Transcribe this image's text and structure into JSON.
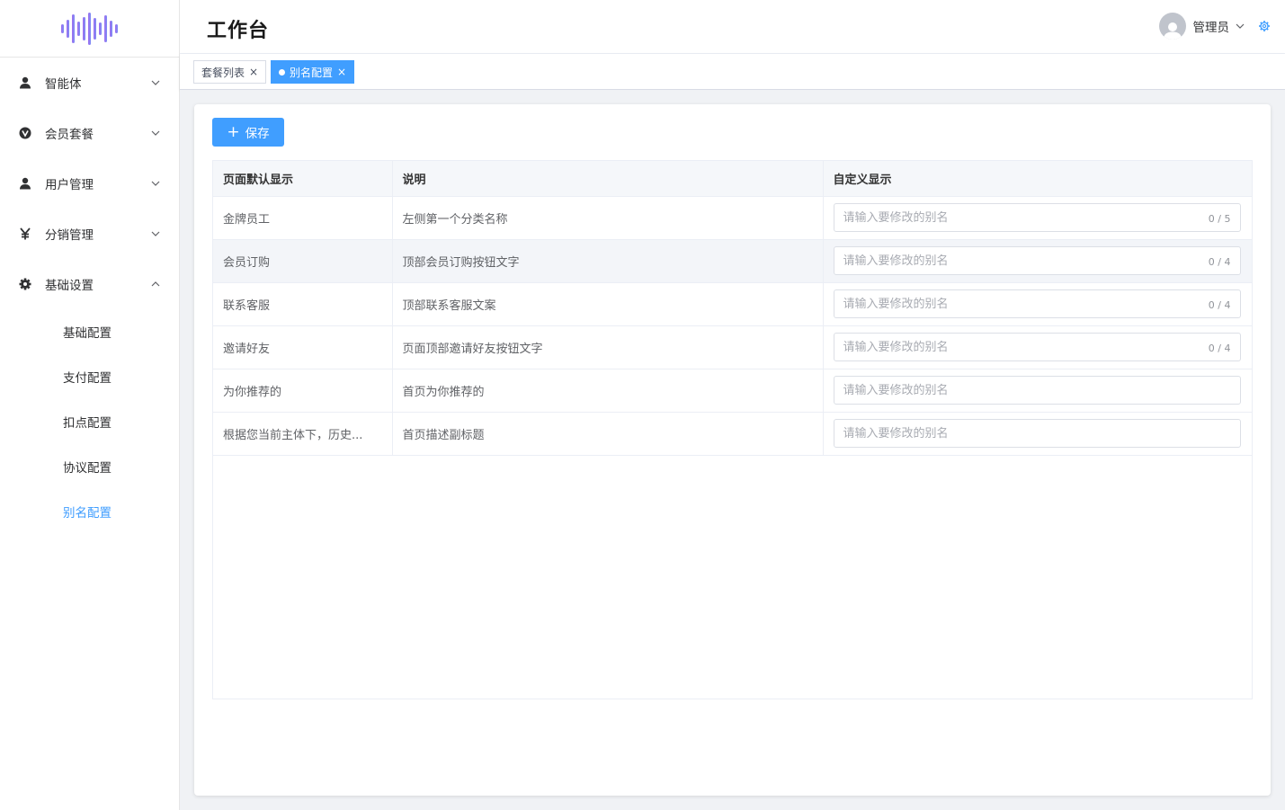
{
  "header": {
    "title": "工作台",
    "user_name": "管理员"
  },
  "sidebar": {
    "items": [
      {
        "label": "智能体",
        "icon": "user-icon",
        "expanded": false
      },
      {
        "label": "会员套餐",
        "icon": "vip-icon",
        "expanded": false
      },
      {
        "label": "用户管理",
        "icon": "user-icon",
        "expanded": false
      },
      {
        "label": "分销管理",
        "icon": "yen-icon",
        "expanded": false
      },
      {
        "label": "基础设置",
        "icon": "gear-icon",
        "expanded": true
      }
    ],
    "submenu": [
      {
        "label": "基础配置",
        "active": false
      },
      {
        "label": "支付配置",
        "active": false
      },
      {
        "label": "扣点配置",
        "active": false
      },
      {
        "label": "协议配置",
        "active": false
      },
      {
        "label": "别名配置",
        "active": true
      }
    ]
  },
  "tabs": [
    {
      "label": "套餐列表",
      "active": false
    },
    {
      "label": "别名配置",
      "active": true
    }
  ],
  "toolbar": {
    "save_label": "保存",
    "save_icon": "+"
  },
  "table": {
    "columns": [
      "页面默认显示",
      "说明",
      "自定义显示"
    ],
    "placeholder": "请输入要修改的别名",
    "rows": [
      {
        "default": "金牌员工",
        "desc": "左侧第一个分类名称",
        "value": "",
        "counter": "0 / 5"
      },
      {
        "default": "会员订购",
        "desc": "顶部会员订购按钮文字",
        "value": "",
        "counter": "0 / 4"
      },
      {
        "default": "联系客服",
        "desc": "顶部联系客服文案",
        "value": "",
        "counter": "0 / 4"
      },
      {
        "default": "邀请好友",
        "desc": "页面顶部邀请好友按钮文字",
        "value": "",
        "counter": "0 / 4"
      },
      {
        "default": "为你推荐的",
        "desc": "首页为你推荐的",
        "value": "",
        "counter": ""
      },
      {
        "default": "根据您当前主体下，历史...",
        "desc": "首页描述副标题",
        "value": "",
        "counter": ""
      }
    ]
  },
  "colors": {
    "accent": "#409eff",
    "logo_gradient": [
      "#9b6cf0",
      "#6a8cf5"
    ]
  }
}
